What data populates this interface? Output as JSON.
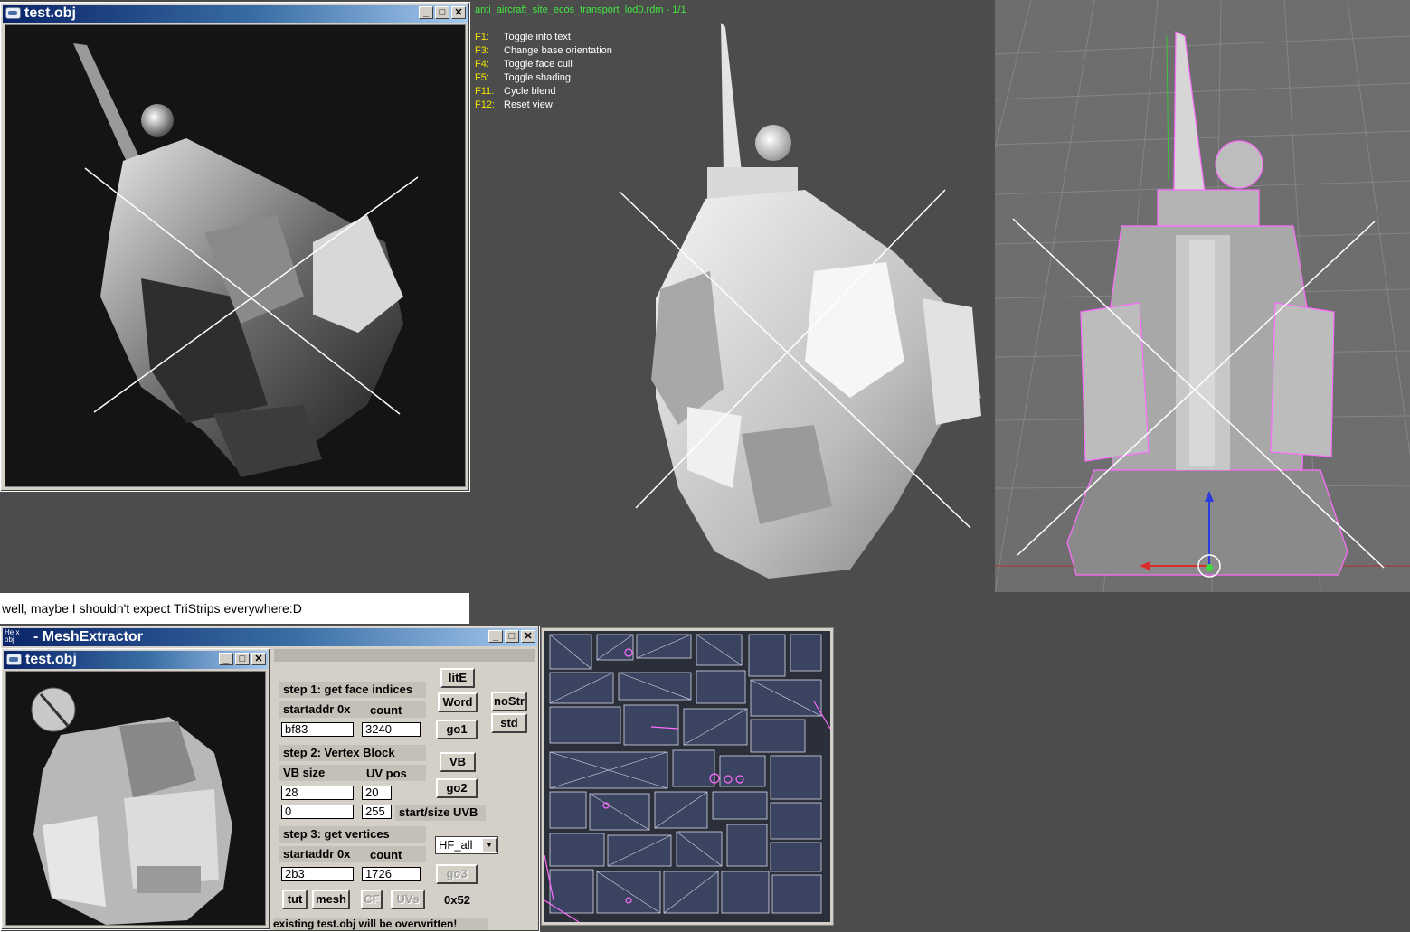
{
  "colors": {
    "viewer_bg": "#4c4c4c",
    "info_title": "#41e641",
    "info_key": "#f4e600",
    "titlebar_start": "#0a246a",
    "titlebar_end": "#a6caf0",
    "wire": "#ff6cff"
  },
  "window_top": {
    "title": "test.obj",
    "icon": "app-icon"
  },
  "viewer": {
    "filename": "anti_aircraft_site_ecos_transport_lod0.rdm - 1/1",
    "keys": [
      {
        "key": "F1:",
        "action": "Toggle info text"
      },
      {
        "key": "F3:",
        "action": "Change base orientation"
      },
      {
        "key": "F4:",
        "action": "Toggle face cull"
      },
      {
        "key": "F5:",
        "action": "Toggle shading"
      },
      {
        "key": "F11:",
        "action": "Cycle blend"
      },
      {
        "key": "F12:",
        "action": "Reset view"
      }
    ]
  },
  "caption": "well, maybe I shouldn't expect TriStrips everywhere:D",
  "mesh_extractor": {
    "title": "- MeshExtractor",
    "app_icon_text": "He x obj",
    "child_title": "test.obj",
    "step1": {
      "heading": "step 1: get face indices",
      "startaddr_label": "startaddr 0x",
      "count_label": "count",
      "startaddr_value": "bf83",
      "count_value": "3240"
    },
    "step2": {
      "heading": "step 2: Vertex Block",
      "vbsize_label": "VB size",
      "uvpos_label": "UV pos",
      "vbsize_value": "28",
      "uvpos_value": "20",
      "start_value": "0",
      "size_value": "255",
      "startsize_label": "start/size UVB"
    },
    "step3": {
      "heading": "step 3: get vertices",
      "startaddr_label": "startaddr 0x",
      "count_label": "count",
      "startaddr_value": "2b3",
      "count_value": "1726"
    },
    "buttons": {
      "lite": "litE",
      "word": "Word",
      "nostr": "noStr",
      "std": "std",
      "go1": "go1",
      "vb": "VB",
      "go2": "go2",
      "go3": "go3",
      "tut": "tut",
      "mesh": "mesh",
      "cf": "CF",
      "uvs": "UVs"
    },
    "format_select": "HF_all",
    "hex_value": "0x52",
    "status": "existing test.obj will be overwritten!"
  }
}
